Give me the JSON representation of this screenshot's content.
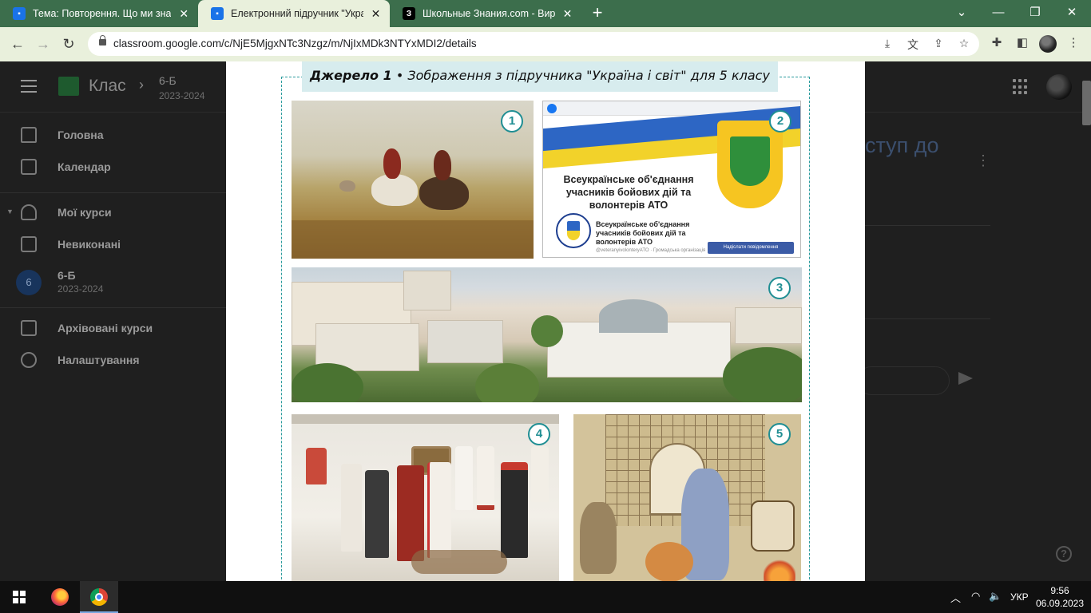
{
  "browser": {
    "tabs": [
      {
        "title": "Тема: Повторення. Що ми знаєм",
        "favicon": "classroom-icon",
        "active": false
      },
      {
        "title": "Електронний підручник \"Україн",
        "favicon": "classroom-icon",
        "active": true
      },
      {
        "title": "Школьные Знания.com - Вирішу",
        "favicon": "znania-icon",
        "favicon_text": "З",
        "active": false
      }
    ],
    "new_tab": "+",
    "url": "classroom.google.com/c/NjE5MjgxNTc3Nzgz/m/NjIxMDk3NTYxMDI2/details"
  },
  "classroom": {
    "app_title": "Клас",
    "breadcrumb": {
      "course": "6-Б",
      "year": "2023-2024"
    },
    "sidebar": {
      "items": [
        {
          "label": "Головна",
          "icon": "home-icon"
        },
        {
          "label": "Календар",
          "icon": "calendar-icon"
        },
        {
          "label": "Мої курси",
          "icon": "school-icon"
        },
        {
          "label": "Невиконані",
          "icon": "checklist-icon"
        },
        {
          "label": "6-Б",
          "sub": "2023-2024",
          "badge": "6"
        },
        {
          "label": "Архівовані курси",
          "icon": "archive-icon"
        },
        {
          "label": "Налаштування",
          "icon": "gear-icon"
        }
      ]
    },
    "background_heading": "ступ до"
  },
  "document": {
    "source_label": "Джерело 1",
    "source_caption": " • Зображення з підручника \"Україна і світ\" для 5 класу",
    "photos": [
      {
        "number": "1",
        "description": "painting-riders"
      },
      {
        "number": "2",
        "description": "facebook-page-screenshot"
      },
      {
        "number": "3",
        "description": "city-parliament-view"
      },
      {
        "number": "4",
        "description": "museum-embroidered-clothing"
      },
      {
        "number": "5",
        "description": "medieval-kitchen-miniature"
      }
    ],
    "fb_page": {
      "title": "Всеукраїнське об'єднання учасників бойових дій та волонтерів АТО",
      "name": "Всеукраїнське об'єднання учасників бойових дій та волонтерів АТО",
      "handle": "@veteranyivolonteryATO · Громадська організація",
      "button": "Надіслати повідомлення"
    }
  },
  "taskbar": {
    "language": "УКР",
    "time": "9:56",
    "date": "06.09.2023"
  },
  "colors": {
    "chrome_frame": "#3c6e4c",
    "toolbar": "#e9f0dc",
    "accent_teal": "#1f8e93"
  }
}
